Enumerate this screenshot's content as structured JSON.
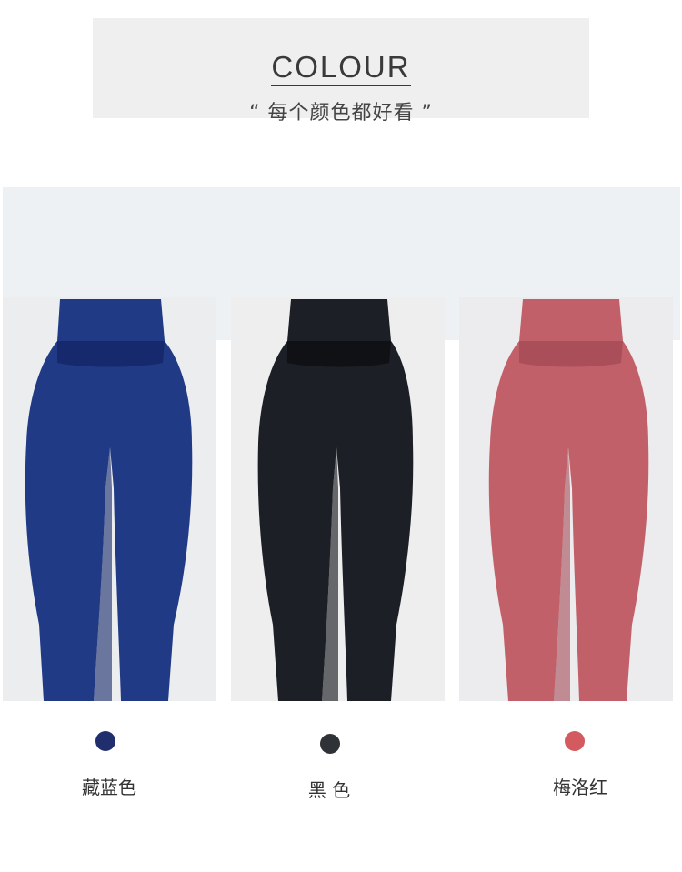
{
  "header": {
    "title": "COLOUR",
    "subtitle": "“ 每个颜色都好看 ”"
  },
  "products": [
    {
      "label": "藏蓝色",
      "swatch_color": "#202e6e",
      "garment_color": "#203a86",
      "garment_shade": "#142667",
      "photo_bg": "#ecedef"
    },
    {
      "label": "黑 色",
      "swatch_color": "#2f3236",
      "garment_color": "#1c1f26",
      "garment_shade": "#0c0e12",
      "photo_bg": "#eeeeef"
    },
    {
      "label": "梅洛红",
      "swatch_color": "#d35a5e",
      "garment_color": "#c2606a",
      "garment_shade": "#a44b55",
      "photo_bg": "#ecebed"
    }
  ]
}
